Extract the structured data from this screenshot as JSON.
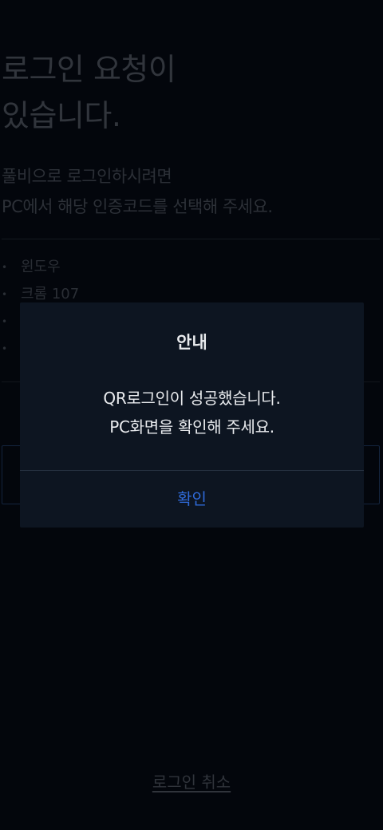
{
  "background": {
    "headline": [
      "로그인 요청이",
      "있습니다."
    ],
    "subtitle": [
      "풀비으로 로그인하시려면",
      "PC에서 해당 인증코드를 선택해 주세요."
    ],
    "codes": [
      "윈도우",
      "크롬 107",
      "",
      ""
    ],
    "cancel_label": "로그인 취소"
  },
  "dialog": {
    "title": "안내",
    "message": [
      "QR로그인이 성공했습니다.",
      "PC화면을 확인해 주세요."
    ],
    "confirm_label": "확인"
  },
  "colors": {
    "page_background": "#03060c",
    "dialog_background": "#0d1521",
    "accent": "#2f6ad8",
    "dialog_text": "#e9ebee"
  }
}
